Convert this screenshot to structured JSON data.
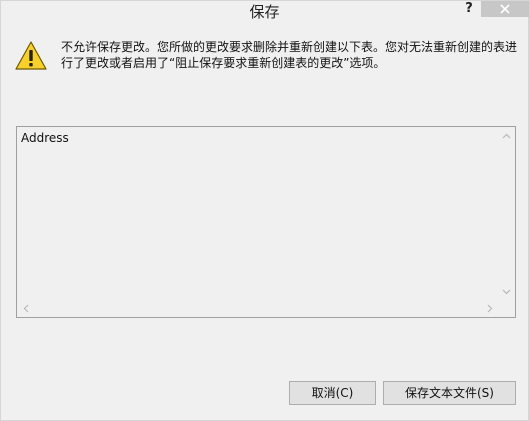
{
  "window": {
    "title": "保存",
    "help_label": "?"
  },
  "dialog": {
    "message": "不允许保存更改。您所做的更改要求删除并重新创建以下表。您对无法重新创建的表进行了更改或者启用了“阻止保存要求重新创建表的更改”选项。",
    "icon": "warning-icon"
  },
  "table_list": {
    "items": [
      "Address"
    ]
  },
  "buttons": {
    "cancel_label": "取消(C)",
    "save_text_label": "保存文本文件(S)"
  },
  "colors": {
    "window_bg": "#f0f0f0",
    "close_bg": "#c7c7c7",
    "warning_yellow": "#f7d02b"
  }
}
